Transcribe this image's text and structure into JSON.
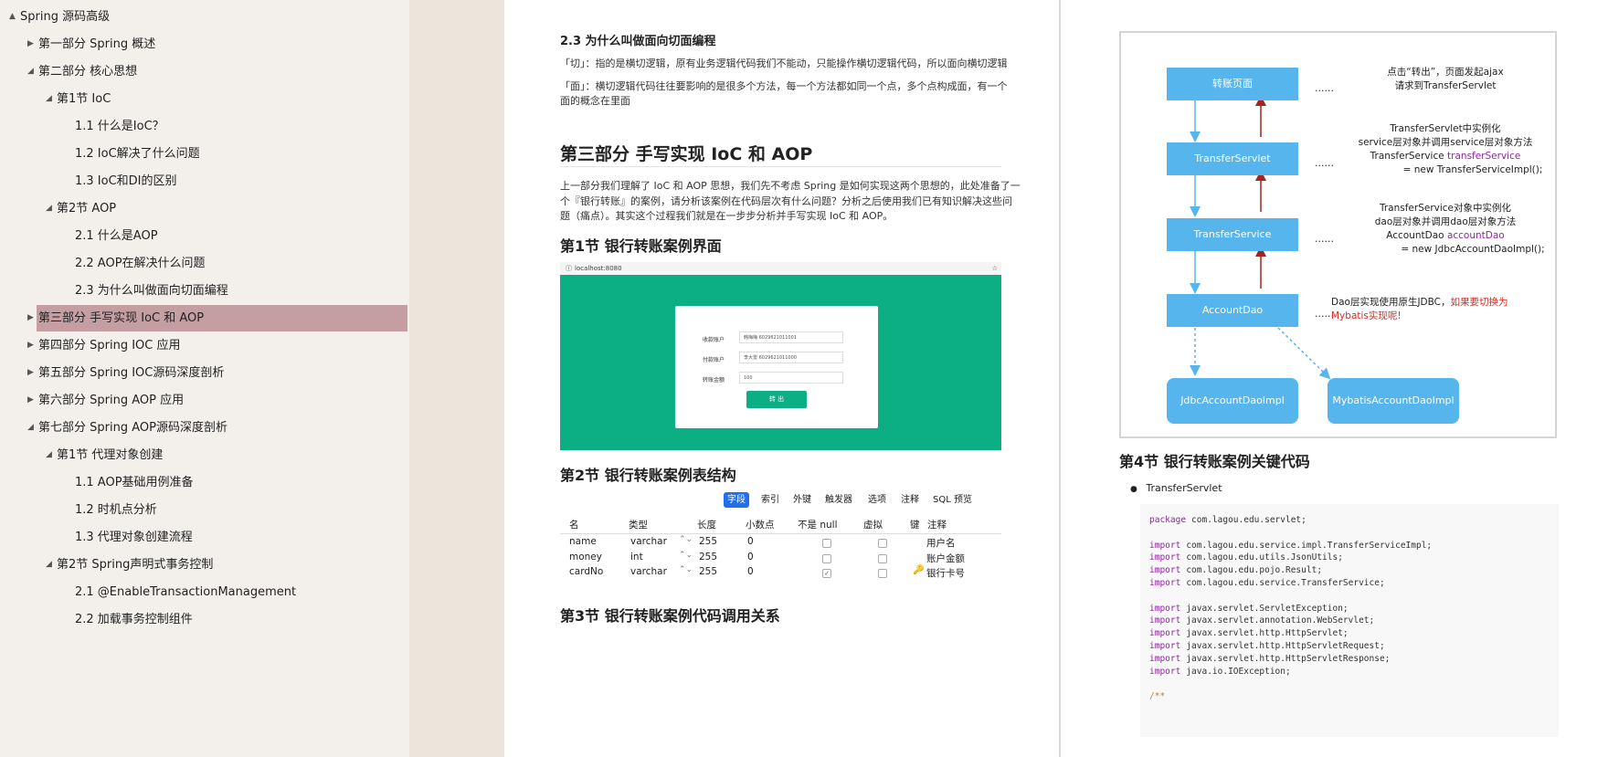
{
  "sidebar": {
    "items": [
      {
        "label": "Spring 源码高级",
        "arrow": "▲"
      },
      {
        "label": "第一部分 Spring 概述",
        "arrow": "▶"
      },
      {
        "label": "第二部分 核心思想",
        "arrow": "◢"
      },
      {
        "label": "第1节 IoC",
        "arrow": "◢"
      },
      {
        "label": "1.1 什么是IoC？",
        "arrow": ""
      },
      {
        "label": "1.2 IoC解决了什么问题",
        "arrow": ""
      },
      {
        "label": "1.3 IoC和DI的区别",
        "arrow": ""
      },
      {
        "label": "第2节 AOP",
        "arrow": "◢"
      },
      {
        "label": "2.1 什么是AOP",
        "arrow": ""
      },
      {
        "label": "2.2 AOP在解决什么问题",
        "arrow": ""
      },
      {
        "label": "2.3 为什么叫做面向切面编程",
        "arrow": ""
      },
      {
        "label": "第三部分 手写实现 IoC 和 AOP",
        "arrow": "▶"
      },
      {
        "label": "第四部分 Spring IOC 应用",
        "arrow": "▶"
      },
      {
        "label": "第五部分 Spring IOC源码深度剖析",
        "arrow": "▶"
      },
      {
        "label": "第六部分 Spring AOP 应用",
        "arrow": "▶"
      },
      {
        "label": "第七部分 Spring AOP源码深度剖析",
        "arrow": "◢"
      },
      {
        "label": "第1节 代理对象创建",
        "arrow": "◢"
      },
      {
        "label": "1.1 AOP基础用例准备",
        "arrow": ""
      },
      {
        "label": "1.2 时机点分析",
        "arrow": ""
      },
      {
        "label": "1.3 代理对象创建流程",
        "arrow": ""
      },
      {
        "label": "第2节 Spring声明式事务控制",
        "arrow": "◢"
      },
      {
        "label": "2.1 @EnableTransactionManagement",
        "arrow": ""
      },
      {
        "label": "2.2 加载事务控制组件",
        "arrow": ""
      }
    ]
  },
  "page1": {
    "sec23_title": "2.3 为什么叫做面向切面编程",
    "para_qie": "「切」：指的是横切逻辑，原有业务逻辑代码我们不能动，只能操作横切逻辑代码，所以面向横切逻辑",
    "para_mian_1": "「面」：横切逻辑代码往往要影响的是很多个方法，每一个方法都如同一个点，多个点构成面，有一个",
    "para_mian_2": "面的概念在里面",
    "part3_title": "第三部分 手写实现 IoC 和 AOP",
    "intro_1": "上一部分我们理解了 IoC 和 AOP 思想，我们先不考虑 Spring 是如何实现这两个思想的，此处准备了一",
    "intro_2": "个『银行转账』的案例，请分析该案例在代码层次有什么问题？分析之后使用我们已有知识解决这些问",
    "intro_3": "题（痛点）。其实这个过程我们就是在一步步分析并手写实现 IoC 和 AOP。",
    "sec1_title": "第1节 银行转账案例界面",
    "shot": {
      "url": "localhost:8080",
      "star": "☆",
      "fields": [
        {
          "label": "收款账户",
          "value": "韩梅梅 6029621011001"
        },
        {
          "label": "付款账户",
          "value": "李大雷 6029621011000"
        },
        {
          "label": "转账金额",
          "value": "100"
        }
      ],
      "button": "转 出"
    },
    "sec2_title": "第2节 银行转账案例表结构",
    "tabs": [
      "字段",
      "索引",
      "外键",
      "触发器",
      "选项",
      "注释",
      "SQL 预览"
    ],
    "columns": [
      "名",
      "类型",
      "长度",
      "小数点",
      "不是 null",
      "虚拟",
      "键",
      "注释"
    ],
    "rows": [
      {
        "name": "name",
        "type": "varchar",
        "len": "255",
        "dec": "0",
        "notnull": "",
        "key": "",
        "comment": "用户名"
      },
      {
        "name": "money",
        "type": "int",
        "len": "255",
        "dec": "0",
        "notnull": "",
        "key": "",
        "comment": "账户金额"
      },
      {
        "name": "cardNo",
        "type": "varchar",
        "len": "255",
        "dec": "0",
        "notnull": "✓",
        "key": "🔑",
        "comment": "银行卡号"
      }
    ],
    "sec3_title": "第3节 银行转账案例代码调用关系"
  },
  "diagram": {
    "boxes": [
      "转账页面",
      "TransferServlet",
      "TransferService",
      "AccountDao",
      "JdbcAccountDaoImpl",
      "MybatisAccountDaoImpl"
    ],
    "dots": "……",
    "note1": [
      "点击“转出”，页面发起ajax",
      "请求到TransferServlet"
    ],
    "note2": [
      "TransferServlet中实例化",
      "service层对象并调用service层对象方法",
      "TransferService ",
      "transferService",
      "= new TransferServiceImpl();"
    ],
    "note3": [
      "TransferService对象中实例化",
      "dao层对象并调用dao层对象方法",
      "AccountDao ",
      "accountDao",
      "= new JdbcAccountDaoImpl();"
    ],
    "note4": [
      "Dao层实现使用原生JDBC，",
      "如果要切换为",
      "Mybatis实现呢!"
    ]
  },
  "page2": {
    "sec4_title": "第4节 银行转账案例关键代码",
    "bullet": "TransferServlet",
    "code": [
      [
        "package",
        "com.lagou.edu.servlet;"
      ],
      [
        "",
        ""
      ],
      [
        "import",
        "com.lagou.edu.service.impl.TransferServiceImpl;"
      ],
      [
        "import",
        "com.lagou.edu.utils.JsonUtils;"
      ],
      [
        "import",
        "com.lagou.edu.pojo.Result;"
      ],
      [
        "import",
        "com.lagou.edu.service.TransferService;"
      ],
      [
        "",
        ""
      ],
      [
        "import",
        "javax.servlet.ServletException;"
      ],
      [
        "import",
        "javax.servlet.annotation.WebServlet;"
      ],
      [
        "import",
        "javax.servlet.http.HttpServlet;"
      ],
      [
        "import",
        "javax.servlet.http.HttpServletRequest;"
      ],
      [
        "import",
        "javax.servlet.http.HttpServletResponse;"
      ],
      [
        "import",
        "java.io.IOException;"
      ],
      [
        "",
        ""
      ],
      [
        "/**",
        ""
      ]
    ]
  },
  "colors": {
    "accent": "#1f6ff0",
    "diagram_box": "#56b5ec",
    "sidebar_active": "#c49ea1",
    "screenshot_green": "#0cae84"
  }
}
